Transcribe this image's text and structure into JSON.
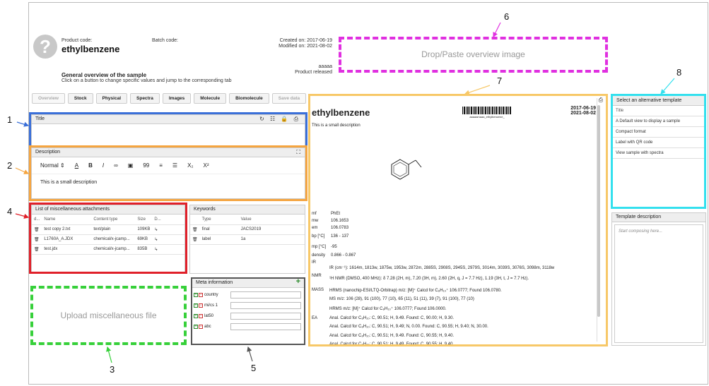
{
  "header": {
    "product_code_label": "Product code:",
    "batch_code_label": "Batch code:",
    "product_name": "ethylbenzene",
    "created": "Created on: 2017-06-19",
    "modified": "Modified on: 2021-08-02",
    "owner": "aaaaa",
    "status": "Product released",
    "overview_title": "General overview of the sample",
    "overview_hint": "Click on a button to change specific values and jump to the corresponding tab"
  },
  "tabs": [
    "Overview",
    "Stock",
    "Physical",
    "Spectra",
    "Images",
    "Molecule",
    "Biomolecule",
    "Save data"
  ],
  "title_panel": {
    "label": "Title"
  },
  "description_panel": {
    "label": "Description",
    "style_select": "Normal",
    "text": "This is a small description",
    "toolbar": [
      "A",
      "B",
      "I",
      "∞",
      "▣",
      "99",
      "≡",
      "☰",
      "X₂",
      "X²"
    ]
  },
  "attachments": {
    "label": "List of miscellaneous attachments",
    "columns": [
      "d...",
      "Name",
      "Content type",
      "Size",
      "D..."
    ],
    "rows": [
      {
        "name": "test copy 2.txt",
        "type": "text/plain",
        "size": "109KB"
      },
      {
        "name": "L1760A_A.JDX",
        "type": "chemical/x-jcamp...",
        "size": "69KB"
      },
      {
        "name": "test.jdx",
        "type": "chemical/x-jcamp...",
        "size": "835B"
      }
    ]
  },
  "keywords": {
    "label": "Keywords",
    "columns": [
      "Type",
      "Value"
    ],
    "rows": [
      {
        "type": "final",
        "value": "JACS2019"
      },
      {
        "type": "label",
        "value": "1a"
      }
    ]
  },
  "upload": {
    "label": "Upload miscellaneous file"
  },
  "meta": {
    "label": "Meta information",
    "items": [
      "country",
      "mi/cs 1",
      "lat50",
      "abc"
    ]
  },
  "drop_image": {
    "label": "Drop/Paste overview image"
  },
  "preview": {
    "name": "ethylbenzene",
    "date1": "2017-06-19",
    "date2": "2021-08-02",
    "barcode_text": "aaaaamaaa_ethylbenzene_",
    "description": "This is a small description",
    "props": [
      {
        "k": "mf",
        "v": "PhEt"
      },
      {
        "k": "mw",
        "v": "106.1653"
      },
      {
        "k": "em",
        "v": "106.0783"
      },
      {
        "k": "bp [°C]",
        "v": "136 - 137"
      },
      {
        "k": "mp [°C]",
        "v": "-95"
      },
      {
        "k": "density",
        "v": "0.866 - 0.867"
      }
    ],
    "ir_key": "IR",
    "ir": "IR (cm⁻¹): 1614m, 1813w, 1875w, 1953w, 2872m, 2885S, 2908S, 2945S, 2979S, 3014m, 3039S, 3076S, 3098m, 3118w",
    "nmr_key": "NMR",
    "nmr": "¹H NMR (DMSO, 400 MHz): δ 7.28 (2H, m), 7.20 (3H, m), 2.60 (2H, q, J = 7.7 Hz), 1.19 (3H, t, J = 7.7 Hz).",
    "mass_key": "MASS",
    "mass": [
      "HRMS (nanochip-ESI/LTQ-Orbitrap) m/z: [M]⁺ Calcd for C₈H₁₀⁺ 106.0777; Found 106.0780.",
      "MS m/z: 106 (28), 91 (100), 77 (10), 65 (11), 51 (11), 39 (7), 91 (100), 77 (10)",
      "HRMS m/z: [M]⁺ Calcd for C₈H₁₀⁺ 106.0777; Found 106.0000."
    ],
    "ea_key": "EA",
    "ea": [
      "Anal. Calcd for C₈H₁₀: C, 90.51; H, 9.49. Found: C, 90.00; H, 9.30.",
      "Anal. Calcd for C₈H₁₀: C, 90.51; H, 9.49; N, 0.00. Found: C, 90.55; H, 9.40; N, 30.00.",
      "Anal. Calcd for C₈H₁₀: C, 90.51; H, 9.49. Found: C, 90.55; H, 9.40.",
      "Anal. Calcd for C₈H₁₀: C, 90.51; H, 9.49. Found: C, 90.55; H, 9.40."
    ]
  },
  "templates": {
    "label": "Select an alternative template",
    "column": "Title",
    "items": [
      "A  Default view to display a sample",
      "Compact format",
      "Label with QR code",
      "View sample with spectra"
    ]
  },
  "template_desc": {
    "label": "Template description",
    "placeholder": "Start composing here..."
  },
  "callouts": [
    "1",
    "2",
    "3",
    "4",
    "5",
    "6",
    "7",
    "8"
  ],
  "colors": {
    "blue": "#3a6fd8",
    "orange": "#f5a540",
    "red": "#e0202a",
    "green": "#37d03a",
    "gray": "#555555",
    "magenta": "#e030e0",
    "yellow": "#f7c868",
    "cyan": "#34e0ee"
  }
}
